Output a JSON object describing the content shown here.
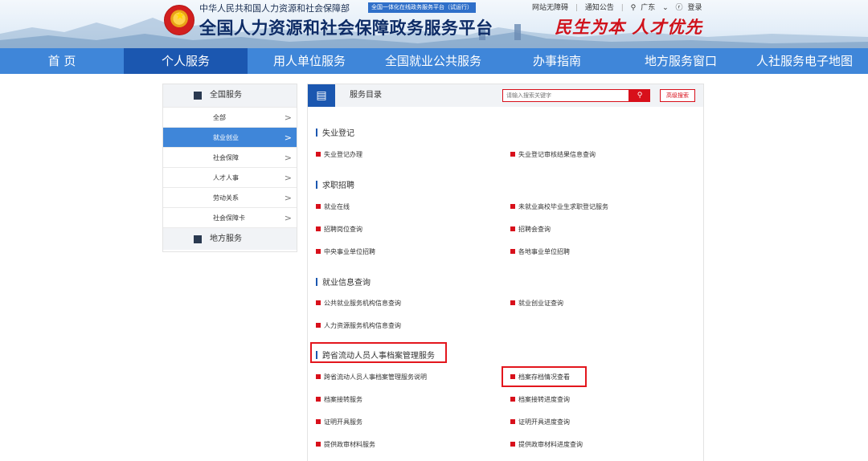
{
  "header": {
    "ministry": "中华人民共和国人力资源和社会保障部",
    "trial_badge": "全国一体化在线政务服务平台（试运行）",
    "platform_title": "全国人力资源和社会保障政务服务平台",
    "slogan": "民生为本 人才优先",
    "toplinks": {
      "accessible": "网站无障碍",
      "notice": "通知公告",
      "region": "广东",
      "login": "登录"
    }
  },
  "nav": {
    "items": [
      "首 页",
      "个人服务",
      "用人单位服务",
      "全国就业公共服务",
      "办事指南",
      "地方服务窗口",
      "人社服务电子地图"
    ],
    "active_index": 1
  },
  "sidebar": {
    "national_label": "全国服务",
    "items": [
      "全部",
      "就业创业",
      "社会保障",
      "人才人事",
      "劳动关系",
      "社会保障卡"
    ],
    "active_index": 1,
    "local_label": "地方服务"
  },
  "panel": {
    "catalog_label": "服务目录",
    "search_placeholder": "请输入搜索关键字",
    "advanced_search": "高级搜索",
    "sections": [
      {
        "title": "失业登记",
        "links": [
          "失业登记办理",
          "失业登记审核结果信息查询"
        ]
      },
      {
        "title": "求职招聘",
        "links": [
          "就业在线",
          "未就业高校毕业生求职登记服务",
          "招聘岗位查询",
          "招聘会查询",
          "中央事业单位招聘",
          "各地事业单位招聘"
        ]
      },
      {
        "title": "就业信息查询",
        "links": [
          "公共就业服务机构信息查询",
          "就业创业证查询",
          "人力资源服务机构信息查询"
        ]
      },
      {
        "title": "跨省流动人员人事档案管理服务",
        "links": [
          "跨省流动人员人事档案管理服务说明",
          "档案存档情况查看",
          "档案接转服务",
          "档案接转进度查询",
          "证明开具服务",
          "证明开具进度查询",
          "提供政审材料服务",
          "提供政审材料进度查询"
        ]
      }
    ]
  },
  "colors": {
    "nav_bg": "#3f86d9",
    "nav_active": "#1b57b0",
    "accent_red": "#d8101b",
    "slogan_red": "#d0121b"
  }
}
